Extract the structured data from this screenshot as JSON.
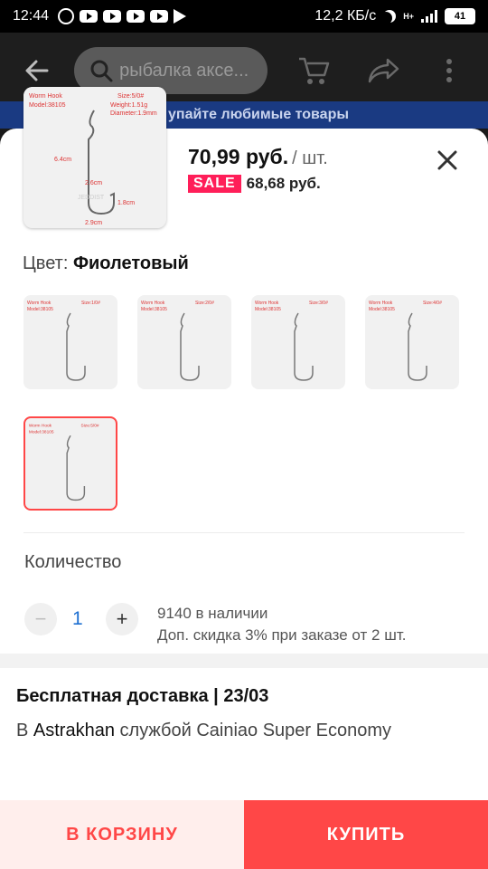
{
  "status_bar": {
    "time": "12:44",
    "net_speed": "12,2 КБ/с",
    "network": "H+",
    "battery": "41"
  },
  "header": {
    "search_text": "рыбалка аксе...",
    "promo_text": "упайте любимые товары"
  },
  "product": {
    "image_labels": {
      "title": "Worm Hook",
      "model": "Model:38105",
      "size": "Size:5/0#",
      "weight": "Weight:1.51g",
      "diameter": "Diameter:1.9mm",
      "length": "6.4cm",
      "gap": "2.6cm",
      "shank": "1.8cm",
      "width": "2.9cm",
      "watermark": "JEDDIST"
    },
    "price": "70,99 руб.",
    "price_unit": "/ шт.",
    "sale_badge": "SALE",
    "sale_price": "68,68 руб."
  },
  "color": {
    "label": "Цвет:",
    "value": "Фиолетовый"
  },
  "variants": [
    {
      "title": "Worm Hook",
      "model": "Model:38105",
      "size": "Size:1/0#",
      "selected": false
    },
    {
      "title": "Worm Hook",
      "model": "Model:38105",
      "size": "Size:2/0#",
      "selected": false
    },
    {
      "title": "Worm Hook",
      "model": "Model:38105",
      "size": "Size:3/0#",
      "selected": false
    },
    {
      "title": "Worm Hook",
      "model": "Model:38105",
      "size": "Size:4/0#",
      "selected": false
    },
    {
      "title": "Worm Hook",
      "model": "Model:38105",
      "size": "Size:5/0#",
      "selected": true
    }
  ],
  "quantity": {
    "title": "Количество",
    "minus": "−",
    "value": "1",
    "plus": "+",
    "stock": "9140 в наличии",
    "discount": "Доп. скидка 3% при заказе от 2 шт."
  },
  "shipping": {
    "title": "Бесплатная доставка | 23/03",
    "prefix": "В",
    "city": "Astrakhan",
    "service": "службой Cainiao Super Economy"
  },
  "actions": {
    "cart": "В КОРЗИНУ",
    "buy": "КУПИТЬ"
  },
  "colors": {
    "accent": "#ff4747",
    "sale": "#ff1e59",
    "qty": "#1d6fd1"
  }
}
